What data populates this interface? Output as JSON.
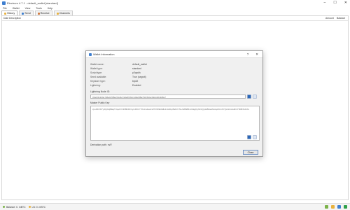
{
  "window": {
    "title": "Electrum 4.7.1 - default_wallet [standard]",
    "controls": [
      "–",
      "☐",
      "✕"
    ]
  },
  "menu": [
    "File",
    "Wallet",
    "View",
    "Tools",
    "Help"
  ],
  "tabs": [
    {
      "label": "History",
      "color": "#e8b23e"
    },
    {
      "label": "Send",
      "color": "#3f7fd0"
    },
    {
      "label": "Receive",
      "color": "#d07a3f"
    },
    {
      "label": "Channels",
      "color": "#e8b23e"
    }
  ],
  "grid": {
    "columns": {
      "date": "Date",
      "description": "Description",
      "amount": "Amount",
      "balance": "Balance"
    }
  },
  "statusbar": {
    "balance": "Balance: 0. mBTC",
    "lightning": "LN: 0. mBTC"
  },
  "dialog": {
    "title": "Wallet Information",
    "controls": [
      "?",
      "✕"
    ],
    "rows": [
      {
        "label": "Wallet name:",
        "value": "default_wallet"
      },
      {
        "label": "Wallet type:",
        "value": "standard"
      },
      {
        "label": "Script type:",
        "value": "p2wpkh"
      },
      {
        "label": "Seed available:",
        "value": "True (segwit)"
      },
      {
        "label": "Keystore type:",
        "value": "bip32"
      },
      {
        "label": "Lightning:",
        "value": "Enabled"
      }
    ],
    "lightning_node_label": "Lightning Node ID:",
    "lightning_node_value": "03a1f4c2b9e7d6a0c5f8e2b1d4c7a9e6f3b2c1d0e9f8a7b6c5d4e3f2a1b0c9d8e7",
    "master_key_label": "Master Public Key",
    "master_key_value": "zpub6rFR7y4Q2AijBEqTUquhVz398htDFrtymD9xYYfG1m4wAcvPhXNfE3EfH1r1ADqtfSdVCToUG868RvUUkgDyf2zJQp1k8Za2A4AqcKLbSYQx1kCoGdF4Y9bB3hJcKx",
    "derivation": "Derivation path: m/0'",
    "close_label": "Close"
  }
}
